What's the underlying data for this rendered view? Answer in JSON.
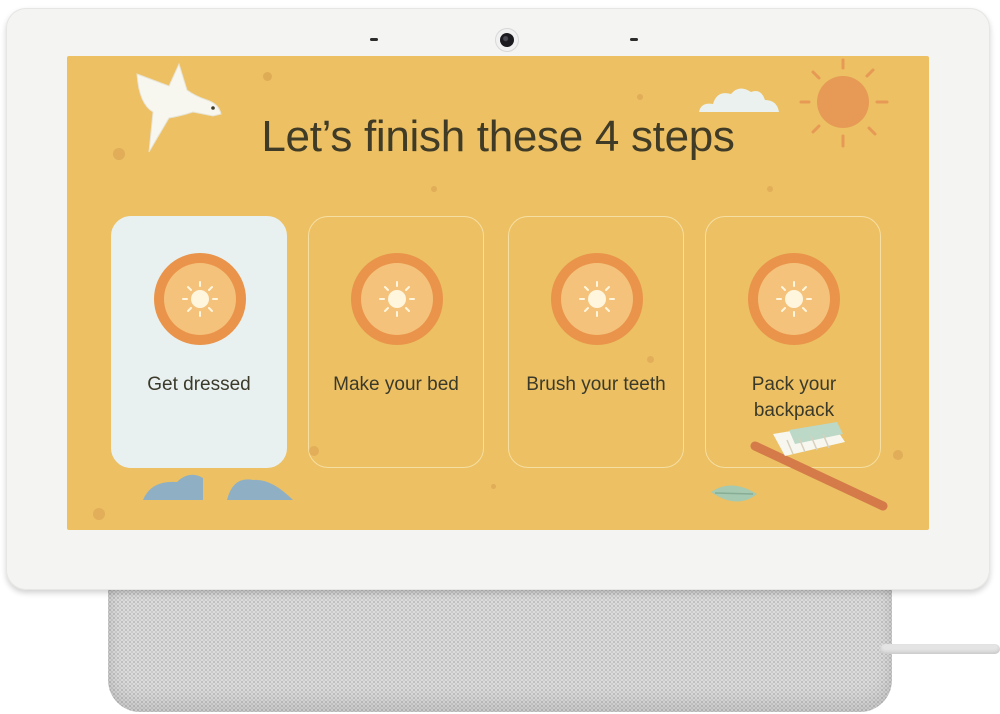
{
  "screen": {
    "title": "Let’s finish these 4 steps",
    "background_color": "#ecc063",
    "steps": [
      {
        "label": "Get dressed",
        "active": true,
        "icon": "sun-icon"
      },
      {
        "label": "Make your bed",
        "active": false,
        "icon": "sun-icon"
      },
      {
        "label": "Brush your teeth",
        "active": false,
        "icon": "sun-icon"
      },
      {
        "label": "Pack your backpack",
        "active": false,
        "icon": "sun-icon"
      }
    ]
  },
  "colors": {
    "accent_orange": "#e9944a",
    "icon_fill": "#f5c27b",
    "active_card": "#e9f1f0",
    "text": "#3f3b26"
  },
  "decorations": [
    "bird-illustration",
    "sun-illustration",
    "cloud-illustration",
    "toothbrush-illustration",
    "leaf-illustration",
    "stones-illustration"
  ]
}
